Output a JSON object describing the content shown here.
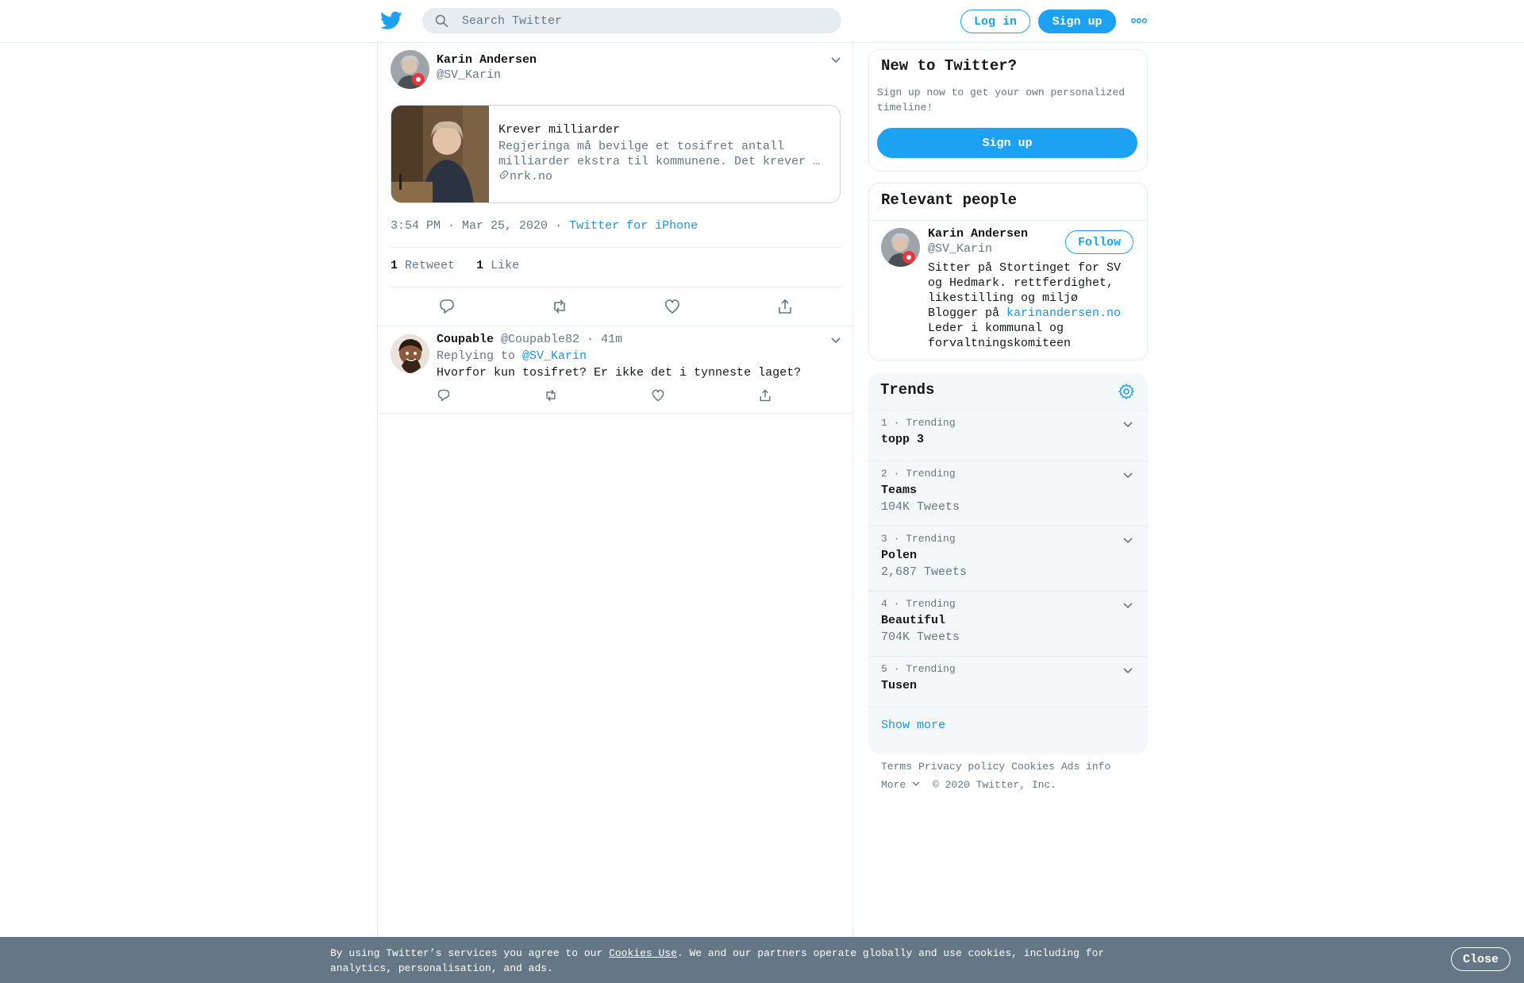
{
  "header": {
    "search_placeholder": "Search Twitter",
    "login_label": "Log in",
    "signup_label": "Sign up"
  },
  "main_tweet": {
    "author_name": "Karin Andersen",
    "author_handle": "@SV_Karin",
    "card": {
      "title": "Krever milliarder",
      "description": "Regjeringa må bevilge et tosifret antall milliarder ekstra til kommunene. Det krever …",
      "domain": "nrk.no"
    },
    "time": "3:54 PM · Mar 25, 2020",
    "sep": "·",
    "source": "Twitter for iPhone",
    "retweet_count": "1",
    "retweet_label": "Retweet",
    "like_count": "1",
    "like_label": "Like"
  },
  "reply": {
    "author_name": "Coupable",
    "author_handle": "@Coupable82",
    "time": "· 41m",
    "replying_to_label": "Replying to",
    "replying_to_handle": "@SV_Karin",
    "text": "Hvorfor kun tosifret? Er ikke det i tynneste laget?"
  },
  "new_to_twitter": {
    "title": "New to Twitter?",
    "text": "Sign up now to get your own personalized timeline!",
    "button": "Sign up"
  },
  "relevant_people": {
    "title": "Relevant people",
    "name": "Karin Andersen",
    "handle": "@SV_Karin",
    "follow_label": "Follow",
    "bio_line1": "Sitter på Stortinget for SV og Hedmark. rettferdighet, likestilling og miljø",
    "bio_blogger": "Blogger på",
    "bio_link": "karinandersen.no",
    "bio_line3": "Leder i kommunal og forvaltningskomiteen"
  },
  "trends": {
    "title": "Trends",
    "items": [
      {
        "meta": "1 · Trending",
        "name": "topp 3",
        "count": ""
      },
      {
        "meta": "2 · Trending",
        "name": "Teams",
        "count": "104K Tweets"
      },
      {
        "meta": "3 · Trending",
        "name": "Polen",
        "count": "2,687 Tweets"
      },
      {
        "meta": "4 · Trending",
        "name": "Beautiful",
        "count": "704K Tweets"
      },
      {
        "meta": "5 · Trending",
        "name": "Tusen",
        "count": ""
      }
    ],
    "show_more": "Show more"
  },
  "footer": {
    "links": [
      "Terms",
      "Privacy policy",
      "Cookies",
      "Ads info"
    ],
    "more": "More",
    "copyright": "© 2020 Twitter, Inc."
  },
  "cookie_bar": {
    "text_before": "By using Twitter’s services you agree to our ",
    "link": "Cookies Use",
    "text_after": ". We and our partners operate globally and use cookies, including for analytics, personalisation, and ads.",
    "close": "Close"
  },
  "colors": {
    "accent": "#1da1f2",
    "text": "#14171a",
    "secondary": "#657786",
    "border": "#e6ecf0",
    "cookie_bar": "#657786"
  }
}
